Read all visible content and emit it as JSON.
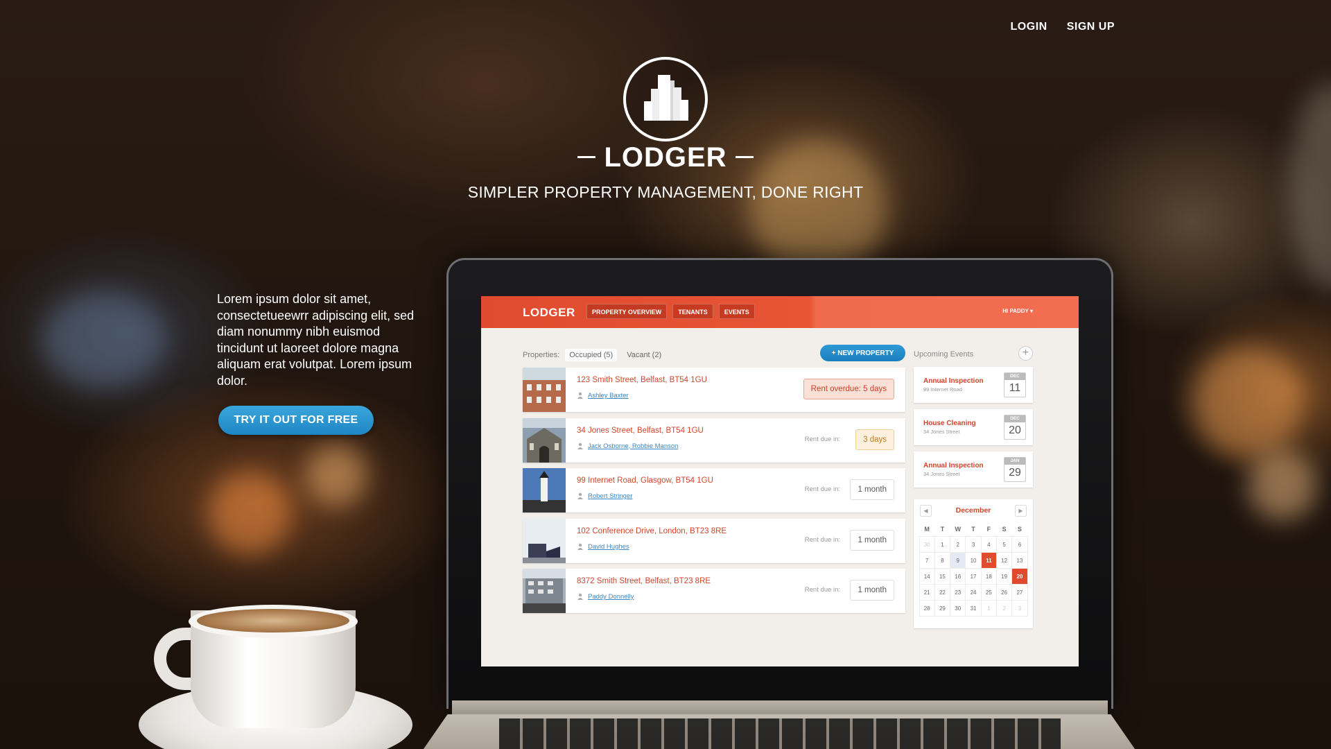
{
  "hero": {
    "nav": {
      "login": "LOGIN",
      "signup": "SIGN UP"
    },
    "brand": "LODGER",
    "tagline": "SIMPLER PROPERTY MANAGEMENT, DONE RIGHT",
    "lede": "Lorem ipsum dolor sit amet, consectetueewrr adipiscing elit, sed diam nonummy nibh euismod tincidunt ut laoreet dolore magna aliquam erat volutpat. Lorem ipsum dolor.",
    "cta": "TRY IT OUT FOR FREE",
    "logo_icon": "city-buildings-icon"
  },
  "app": {
    "logo": "LODGER",
    "tabs": [
      "PROPERTY OVERVIEW",
      "TENANTS",
      "EVENTS"
    ],
    "user_menu": "HI PADDY ▾",
    "accent": "#e04b2f",
    "properties": {
      "label": "Properties:",
      "filters": [
        "Occupied (5)",
        "Vacant (2)"
      ],
      "new_button": "+ NEW PROPERTY",
      "rows": [
        {
          "address": "123 Smith Street, Belfast, BT54 1GU",
          "tenants": "Ashley Baxter",
          "rent_label": "",
          "rent": "Rent overdue: 5 days",
          "status": "overdue"
        },
        {
          "address": "34 Jones Street, Belfast, BT54 1GU",
          "tenants": "Jack Osborne, Robbie Manson",
          "rent_label": "Rent due in:",
          "rent": "3 days",
          "status": "warn"
        },
        {
          "address": "99 Internet Road, Glasgow, BT54 1GU",
          "tenants": "Robert Stringer",
          "rent_label": "Rent due in:",
          "rent": "1 month",
          "status": "ok"
        },
        {
          "address": "102 Conference Drive, London, BT23 8RE",
          "tenants": "David Hughes",
          "rent_label": "Rent due in:",
          "rent": "1 month",
          "status": "ok"
        },
        {
          "address": "8372 Smith Street, Belfast, BT23 8RE",
          "tenants": "Paddy Donnelly",
          "rent_label": "Rent due in:",
          "rent": "1 month",
          "status": "ok"
        }
      ]
    },
    "events": {
      "title": "Upcoming Events",
      "add": "+",
      "items": [
        {
          "name": "Annual Inspection",
          "location": "99 Internet Road",
          "month": "DEC",
          "day": "11"
        },
        {
          "name": "House Cleaning",
          "location": "34 Jones Street",
          "month": "DEC",
          "day": "20"
        },
        {
          "name": "Annual Inspection",
          "location": "34 Jones Street",
          "month": "JAN",
          "day": "29"
        }
      ]
    },
    "calendar": {
      "month": "December",
      "prev": "◀",
      "next": "▶",
      "weekdays": [
        "M",
        "T",
        "W",
        "T",
        "F",
        "S",
        "S"
      ],
      "days": [
        {
          "d": "30",
          "m": true
        },
        {
          "d": "1"
        },
        {
          "d": "2"
        },
        {
          "d": "3"
        },
        {
          "d": "4"
        },
        {
          "d": "5"
        },
        {
          "d": "6"
        },
        {
          "d": "7"
        },
        {
          "d": "8"
        },
        {
          "d": "9",
          "today": true
        },
        {
          "d": "10"
        },
        {
          "d": "11",
          "sel": true
        },
        {
          "d": "12"
        },
        {
          "d": "13"
        },
        {
          "d": "14"
        },
        {
          "d": "15"
        },
        {
          "d": "16"
        },
        {
          "d": "17"
        },
        {
          "d": "18"
        },
        {
          "d": "19"
        },
        {
          "d": "20",
          "sel": true
        },
        {
          "d": "21"
        },
        {
          "d": "22"
        },
        {
          "d": "23"
        },
        {
          "d": "24"
        },
        {
          "d": "25"
        },
        {
          "d": "26"
        },
        {
          "d": "27"
        },
        {
          "d": "28"
        },
        {
          "d": "29"
        },
        {
          "d": "30"
        },
        {
          "d": "31"
        },
        {
          "d": "1",
          "m": true
        },
        {
          "d": "2",
          "m": true
        },
        {
          "d": "3",
          "m": true
        }
      ]
    }
  }
}
